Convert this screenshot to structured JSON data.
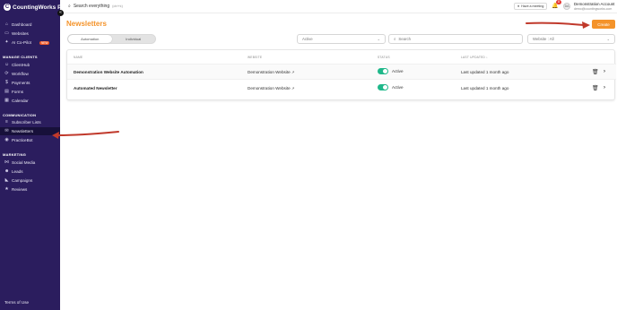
{
  "brand": {
    "name": "CountingWorks PRO",
    "mark": "C"
  },
  "topbar": {
    "search_label": "Search everything",
    "search_kbd": "(ctrl+k)",
    "screen_btn": "Have a meeting",
    "notif_count": "8",
    "avatar_initials": "DA",
    "account_name": "Demonstration Account",
    "account_email": "demo@countingworks.com"
  },
  "sidebar": {
    "top": [
      {
        "label": "Dashboard",
        "icon": "home-icon"
      },
      {
        "label": "Websites",
        "icon": "monitor-icon"
      },
      {
        "label": "AI Co-Pilot",
        "icon": "sparkle-icon",
        "badge": "NEW"
      }
    ],
    "section_manage": "MANAGE CLIENTS",
    "manage": [
      {
        "label": "ClientHub",
        "icon": "users-icon"
      },
      {
        "label": "Workflow",
        "icon": "workflow-icon"
      },
      {
        "label": "Payments",
        "icon": "dollar-icon"
      },
      {
        "label": "Forms",
        "icon": "form-icon"
      },
      {
        "label": "Calendar",
        "icon": "calendar-icon"
      }
    ],
    "section_comm": "COMMUNICATION",
    "comm": [
      {
        "label": "Subscriber Lists",
        "icon": "list-icon"
      },
      {
        "label": "Newsletters",
        "icon": "mail-icon"
      },
      {
        "label": "PracticeBot",
        "icon": "bot-icon"
      }
    ],
    "section_marketing": "MARKETING",
    "marketing": [
      {
        "label": "Social Media",
        "icon": "share-icon"
      },
      {
        "label": "Leads",
        "icon": "leads-icon"
      },
      {
        "label": "Campaigns",
        "icon": "megaphone-icon"
      },
      {
        "label": "Reviews",
        "icon": "star-icon"
      }
    ],
    "footer": "Terms of Use"
  },
  "main": {
    "title": "Newsletters",
    "create_label": "Create",
    "tabs": [
      {
        "label": "Automation"
      },
      {
        "label": "Individual"
      }
    ],
    "status_filter": "Active",
    "search_placeholder": "Search",
    "website_filter": "Website : All",
    "columns": [
      "Name",
      "Website",
      "Status",
      "Last updated ↓"
    ],
    "rows": [
      {
        "name": "Demonstration Website Automation",
        "website": "Demonstration Website",
        "status": "Active",
        "updated": "Last updated 1 month ago"
      },
      {
        "name": "Automated Newsletter",
        "website": "Demonstration Website",
        "status": "Active",
        "updated": "Last updated 1 month ago"
      }
    ]
  },
  "colors": {
    "accent": "#f4932a",
    "sidebar": "#2b1d5e",
    "toggle_on": "#1fb88a",
    "annotation_arrow": "#c0392b"
  }
}
